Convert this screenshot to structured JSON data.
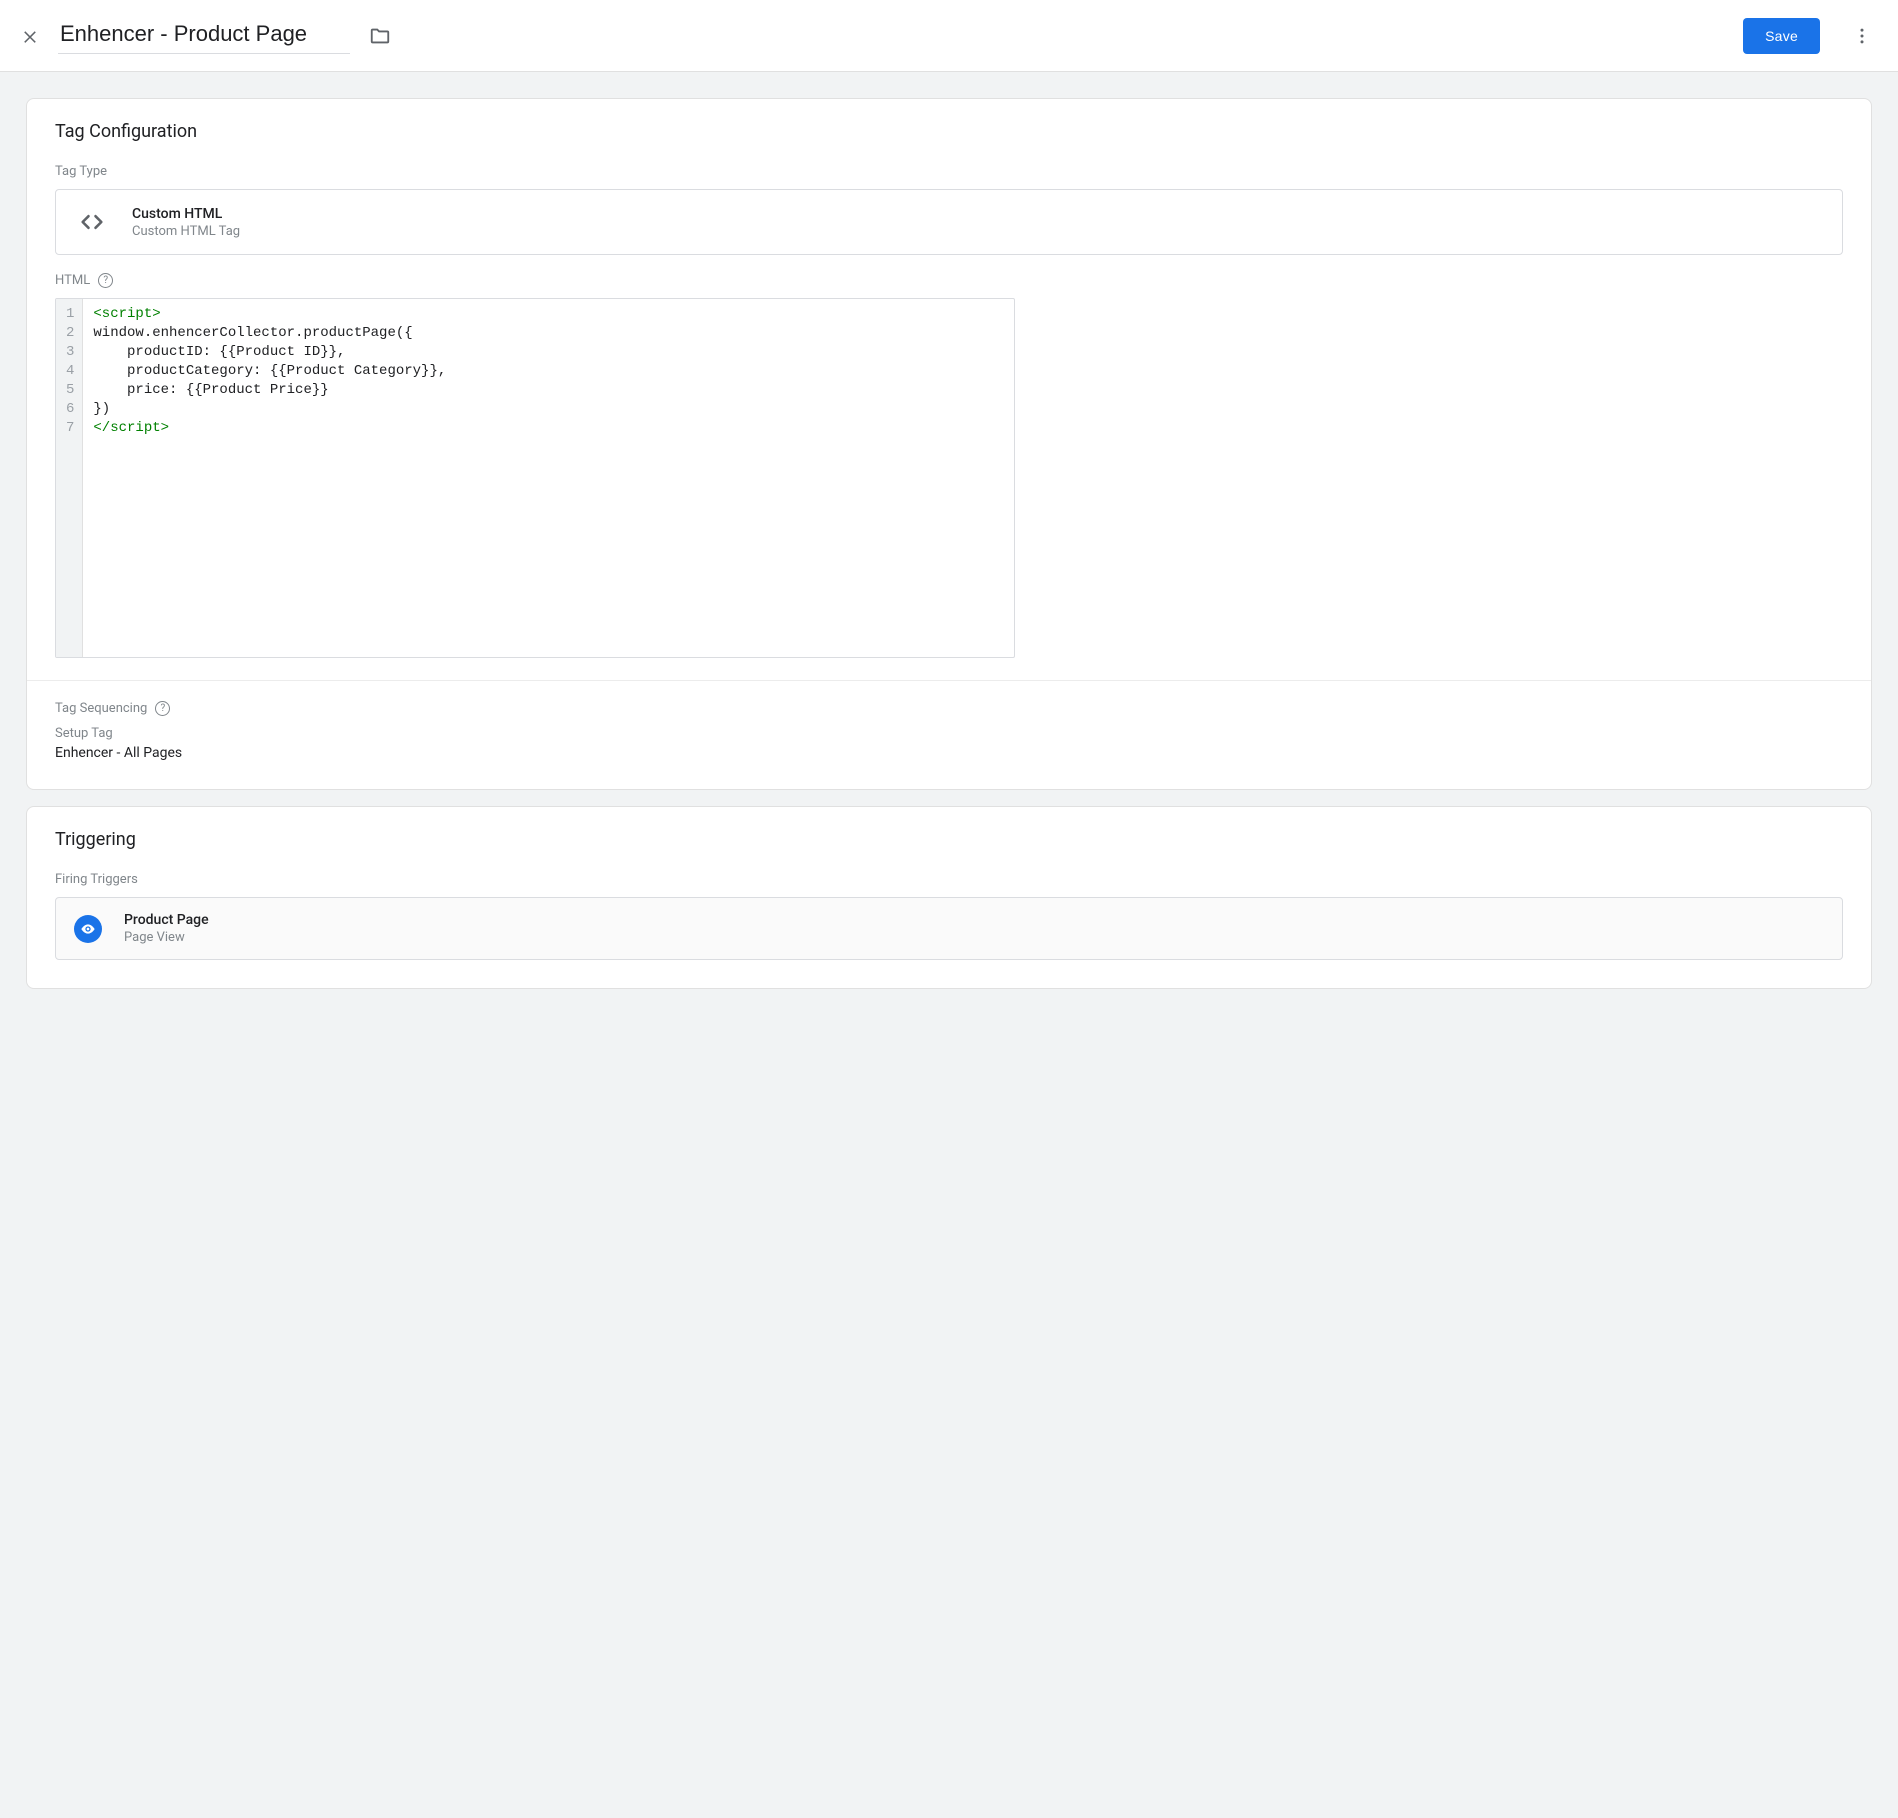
{
  "header": {
    "title": "Enhencer - Product Page",
    "save_label": "Save"
  },
  "tag_config": {
    "section_title": "Tag Configuration",
    "tag_type_label": "Tag Type",
    "type_title": "Custom HTML",
    "type_subtitle": "Custom HTML Tag",
    "html_label": "HTML",
    "code_lines": [
      {
        "t": "tag",
        "v": "<script>"
      },
      {
        "t": "plain",
        "v": "window.enhencerCollector.productPage({"
      },
      {
        "t": "plain",
        "v": "    productID: {{Product ID}},"
      },
      {
        "t": "plain",
        "v": "    productCategory: {{Product Category}},"
      },
      {
        "t": "plain",
        "v": "    price: {{Product Price}}"
      },
      {
        "t": "plain",
        "v": "})"
      },
      {
        "t": "tag",
        "v": "</script>"
      }
    ],
    "tag_sequencing_label": "Tag Sequencing",
    "setup_tag_label": "Setup Tag",
    "setup_tag_value": "Enhencer - All Pages"
  },
  "triggering": {
    "section_title": "Triggering",
    "firing_label": "Firing Triggers",
    "trigger_title": "Product Page",
    "trigger_subtitle": "Page View"
  }
}
